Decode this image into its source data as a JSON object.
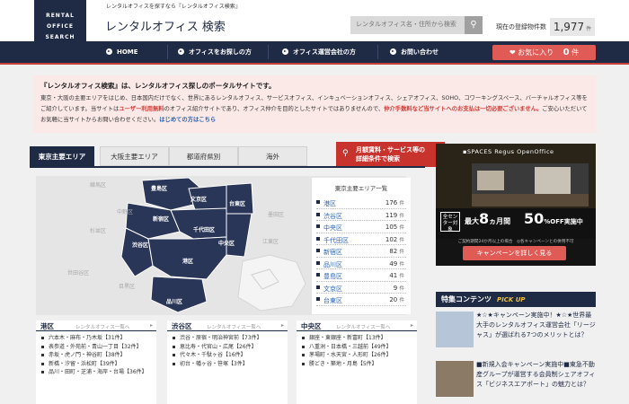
{
  "header": {
    "logo_lines": [
      "RENTAL",
      "OFFICE",
      "SEARCH"
    ],
    "tagline": "レンタルオフィスを探すなら『レンタルオフィス検索』",
    "title": "レンタルオフィス 検索",
    "search_placeholder": "レンタルオフィス名・住所から検索",
    "search_icon": "search-icon",
    "count_label": "現在の登録物件数",
    "count_value": "1,977",
    "count_unit": "件"
  },
  "nav": {
    "items": [
      "HOME",
      "オフィスをお探しの方",
      "オフィス運営会社の方",
      "お問い合わせ"
    ],
    "favorites_label": "お気に入り",
    "favorites_count": "0",
    "favorites_unit": "件"
  },
  "notice": {
    "headline": "『レンタルオフィス検索』は、レンタルオフィス探しのポータルサイトです。",
    "body1": "東京・大阪の主要エリアをはじめ、日本国内だけでなく、世界にあるレンタルオフィス、サービスオフィス、インキュベーションオフィス、シェアオフィス、SOHO、コワーキングスペース、バーチャルオフィス等をご紹介しています。当サイトは",
    "body_red1": "ユーザー利用無料",
    "body2": "のオフィス紹介サイトであり、オフィス仲介を目的としたサイトではありませんので、",
    "body_red2": "仲介手数料など当サイトへのお支払は一切必要ございません。",
    "body3": "ご安心いただいてお気軽に当サイトからお問い合わせください。",
    "body_link": "はじめての方はこちら"
  },
  "area_tabs": {
    "tabs": [
      "東京主要エリア",
      "大阪主要エリア",
      "都道府県別",
      "海外"
    ],
    "active": "東京主要エリア",
    "search_line1": "月額賃料・サービス等の",
    "search_line2": "詳細条件で検索"
  },
  "map": {
    "wards": [
      "豊島区",
      "文京区",
      "台東区",
      "新宿区",
      "千代田区",
      "中央区",
      "渋谷区",
      "港区",
      "品川区"
    ],
    "outside": [
      "中野区",
      "杉並区",
      "世田谷区",
      "目黒区",
      "江東区",
      "墨田区",
      "練馬区"
    ]
  },
  "ranking": {
    "title": "東京主要エリア一覧",
    "unit": "件",
    "items": [
      {
        "name": "港区",
        "count": "176"
      },
      {
        "name": "渋谷区",
        "count": "119"
      },
      {
        "name": "中央区",
        "count": "105"
      },
      {
        "name": "千代田区",
        "count": "102"
      },
      {
        "name": "新宿区",
        "count": "82"
      },
      {
        "name": "品川区",
        "count": "49"
      },
      {
        "name": "豊島区",
        "count": "41"
      },
      {
        "name": "文京区",
        "count": "9"
      },
      {
        "name": "台東区",
        "count": "20"
      }
    ]
  },
  "ward_sections": [
    {
      "name": "港区",
      "page_label": "レンタルオフィス一覧へ",
      "items": [
        "六本木・麻布・乃木坂【31件】",
        "表参道・外苑前・青山一丁目【32件】",
        "赤坂・虎ノ門・神谷町【38件】",
        "新橋・汐留・浜松町【39件】",
        "品川・田町・芝浦・海岸・台場【36件】"
      ]
    },
    {
      "name": "渋谷区",
      "page_label": "レンタルオフィス一覧へ",
      "items": [
        "渋谷・原宿・明治神宮前【73件】",
        "恵比寿・代官山・広尾【26件】",
        "代々木・千駄ヶ谷【16件】",
        "初台・幡ヶ谷・笹塚【3件】"
      ]
    },
    {
      "name": "中央区",
      "page_label": "レンタルオフィス一覧へ",
      "items": [
        "銀座・東銀座・新富町【13件】",
        "八重洲・日本橋・三越前【49件】",
        "茅場町・水天宮・人形町【26件】",
        "勝どき・築地・月島【5件】"
      ]
    }
  ],
  "ad": {
    "logos": "▪SPACES  Regus  OpenOffice",
    "badge": "全センター対象",
    "months_big": "8",
    "months_prefix": "最大",
    "months_suffix": "ヵ月間",
    "pct_big": "50",
    "pct_suffix": "%OFF実施中",
    "note": "ご契約期間24か月以上の場合　◎各キャンペーンとの併用不可",
    "button": "キャンペーンを詳しく見る"
  },
  "features": {
    "title": "特集コンテンツ",
    "pickup": "PICK UP",
    "items": [
      "★☆★キャンペーン実施中！★☆★世界最大手のレンタルオフィス運営会社「リージャス」が選ばれる7つのメリットとは？",
      "■新規入会キャンペーン実施中■東急不動産グループが運営する会員制シェアオフィス「ビジネスエアポート」の魅力とは？"
    ]
  },
  "colors": {
    "navy": "#1f2a44",
    "accent_red": "#c9332e",
    "fav_red": "#e05b55",
    "notice_bg": "#fbe9e7",
    "link_blue": "#2a63b4"
  }
}
